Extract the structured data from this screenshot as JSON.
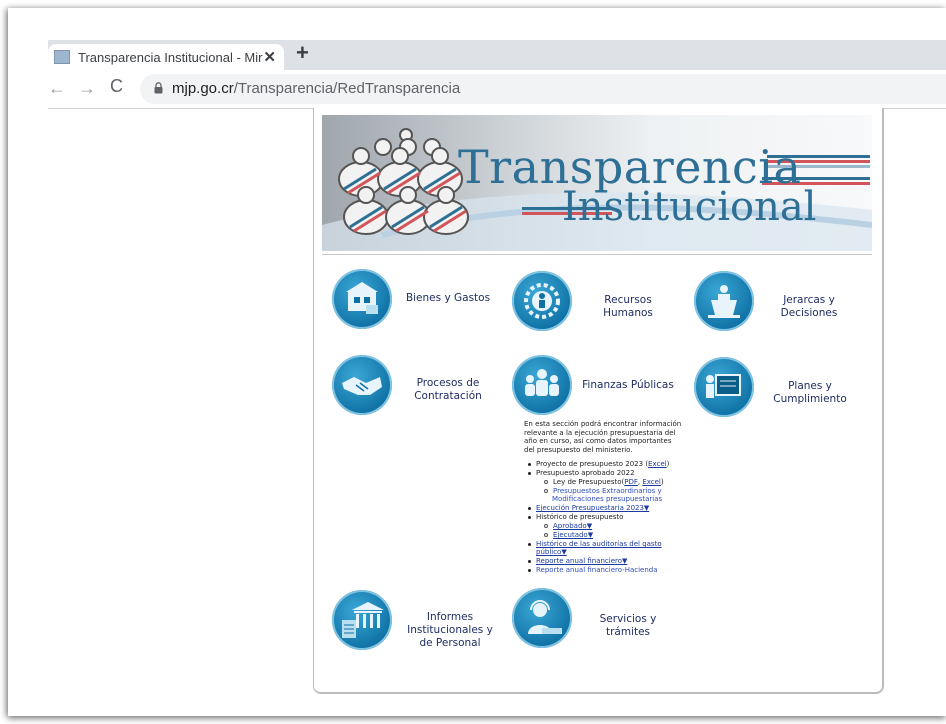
{
  "browser": {
    "tab_title": "Transparencia Institucional - Mir",
    "tab_close": "✕",
    "new_tab": "+",
    "back": "←",
    "forward": "→",
    "reload": "C",
    "url_domain": "mjp.go.cr",
    "url_path": "/Transparencia/RedTransparencia"
  },
  "banner": {
    "title_line1": "Transparencia",
    "title_line2": "Institucional"
  },
  "categories": [
    {
      "label": "Bienes y Gastos",
      "icon": "building-icon"
    },
    {
      "label": "Recursos Humanos",
      "icon": "gear-person-icon"
    },
    {
      "label": "Jerarcas y Decisiones",
      "icon": "podium-speaker-icon"
    },
    {
      "label": "Procesos de Contratación",
      "icon": "handshake-icon"
    },
    {
      "label": "Finanzas Públicas",
      "icon": "group-people-icon"
    },
    {
      "label": "Planes y Cumplimiento",
      "icon": "presentation-board-icon"
    },
    {
      "label": "Informes Institucionales y de Personal",
      "icon": "institution-documents-icon"
    },
    {
      "label": "Servicios y trámites",
      "icon": "customer-service-icon"
    }
  ],
  "finanzas": {
    "description": "En esta sección podrá encontrar información relevante a la ejecución presupuestaria del año en curso, así como datos importantes del presupuesto del ministerio.",
    "items": {
      "proyecto": "Proyecto de presupuesto 2023 (",
      "proyecto_excel": "Excel",
      "proyecto_close": ")",
      "aprobado": "Presupuesto aprobado 2022",
      "ley": "Ley de Presupuesto(",
      "ley_pdf": "PDF",
      "ley_sep": ", ",
      "ley_excel": "Excel",
      "ley_close": ")",
      "extraordinarios_1": "Presupuestos Extraordinarios y",
      "extraordinarios_2": "Modificaciones presupuestarias",
      "ejecucion": "Ejecución Presupuestaria 2023▼",
      "historico": "Histórico de presupuesto",
      "hist_aprobado": "Aprobado▼",
      "hist_ejecutado": "Ejecutado▼",
      "auditorias_1": "Histórico de las auditorías del gasto",
      "auditorias_2": "público▼",
      "reporte": "Reporte anual financiero▼",
      "reporte_hacienda": "Reporte anual financiero-Hacienda"
    }
  }
}
